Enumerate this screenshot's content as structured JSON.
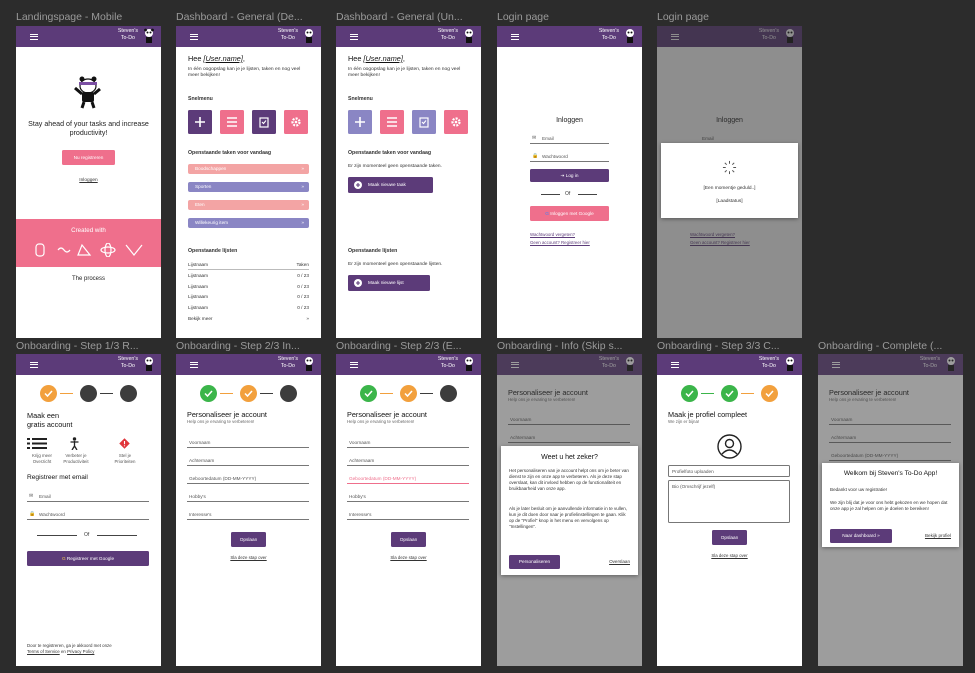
{
  "brand": {
    "line1": "Steven's",
    "line2": "To-Do"
  },
  "frames": [
    {
      "label": "Landingspage - Mobile"
    },
    {
      "label": "Dashboard - General (De..."
    },
    {
      "label": "Dashboard - General (Un..."
    },
    {
      "label": "Login page"
    },
    {
      "label": "Login page"
    },
    {
      "label": "Onboarding - Step 1/3 R..."
    },
    {
      "label": "Onboarding - Step 2/3 In..."
    },
    {
      "label": "Onboarding - Step 2/3 (E..."
    },
    {
      "label": "Onboarding - Info (Skip s..."
    },
    {
      "label": "Onboarding - Step 3/3 C..."
    },
    {
      "label": "Onboarding - Complete (..."
    }
  ],
  "landing": {
    "tagline": "Stay ahead of your tasks and increase productivity!",
    "register_btn": "Nu registreren",
    "login_link": "Inloggen",
    "created_with": "Created with",
    "process": "The process"
  },
  "dash": {
    "greeting_prefix": "Hee ",
    "user": "[User.name]",
    "greeting_suffix": ",",
    "intro": "In één oogopslag kan je je lijsten, taken en nog veel meer bekijken!",
    "quick_menu": "Snelmenu",
    "tasks_title": "Openstaande taken voor vandaag",
    "tasks": [
      {
        "label": "Boodschappen",
        "color": "#f3a4a4"
      },
      {
        "label": "Sporten",
        "color": "#8a86c4"
      },
      {
        "label": "Eten",
        "color": "#f3a4a4"
      },
      {
        "label": "Willekeurig item",
        "color": "#8a86c4"
      }
    ],
    "arrow": "»",
    "lists_title": "Openstaande lijsten",
    "lists_header": {
      "name": "Lijstnaam",
      "tasks": "Taken"
    },
    "lists": [
      {
        "name": "Lijstnaam",
        "count": "0 / 23"
      },
      {
        "name": "Lijstnaam",
        "count": "0 / 23"
      },
      {
        "name": "Lijstnaam",
        "count": "0 / 23"
      },
      {
        "name": "Lijstnaam",
        "count": "0 / 23"
      }
    ],
    "see_more": "Bekijk meer",
    "see_more_arrow": "»",
    "no_tasks": "Er zijn momenteel geen openstaande taken.",
    "new_task": "Maak nieuwe taak",
    "no_lists": "Er zijn momenteel geen openstaande lijsten.",
    "new_list": "Maak nieuwe lijst"
  },
  "login": {
    "title": "Inloggen",
    "email": "Email",
    "password": "Wachtwoord",
    "login_btn": "Log in",
    "or": "Of",
    "google_btn": "Inloggen met Google",
    "forgot": "Wachtwoord vergeten?",
    "no_account": "Geen account? Registreer hier",
    "loading_title": "[Een momentje geduld..]",
    "loading_status": "[Laadstatus]"
  },
  "onb1": {
    "title_l1": "Maak een",
    "title_l2": "gratis account",
    "features": [
      {
        "l1": "Krijg meer",
        "l2": "Overzicht"
      },
      {
        "l1": "Verbeter je",
        "l2": "Productiviteit"
      },
      {
        "l1": "Stel je",
        "l2": "Prioriteiten"
      }
    ],
    "register_email": "Registreer met email",
    "email": "Email",
    "password": "Wachtwoord",
    "or": "Of",
    "google": "Registreer met Google",
    "terms_prefix": "Door te registreren, ga je akkoord met onze",
    "terms": "Terms of Service",
    "and": "en",
    "privacy": "Privacy Policy"
  },
  "onb2": {
    "title": "Personaliseer je account",
    "subtitle": "Help ons je ervaring te verbeteren!",
    "fields": [
      "Voornaam",
      "Achternaam",
      "Geboortedatum (DD-MM-YYYY)",
      "Hobby's",
      "Interesse's"
    ],
    "save": "Opslaan",
    "skip": "Sla deze stap over"
  },
  "info_modal": {
    "title": "Weet u het zeker?",
    "p1": "Het personaliseren van je account helpt ons om je beter van dienst te zijn en onze app te verbeteren. Als je deze stap overslaat, kan dit invloed hebben op de functionaliteit en bruikbaarheid van onze app.",
    "p2": "Als je later besluit om je aanvullende informatie in te vullen, kun je dit doen door naar je profielinstellingen te gaan. Klik op de \"Profiel\" knop in het menu en vervolgens op \"Instellingen\".",
    "primary": "Personaliseren",
    "secondary": "Overslaan"
  },
  "onb3": {
    "title": "Maak je profiel compleet",
    "subtitle": "We zijn er bijna!",
    "upload": "Profielfoto uploaden",
    "bio": "Bio (Omschrijf jezelf)",
    "save": "Opslaan",
    "skip": "Sla deze stap over"
  },
  "complete": {
    "title": "Welkom bij Steven's To-Do App!",
    "p1": "Bedankt voor uw registratie!",
    "p2": "We zijn blij dat je voor ons hebt gekozen en we hopen dat onze app je zal helpen om je doelen te bereiken!",
    "primary": "Naar dashboard »",
    "secondary": "Bekijk profiel"
  },
  "colors": {
    "purple": "#5c3b79",
    "pink": "#ef6f8c",
    "lavender": "#8a86c4",
    "salmon": "#f3a4a4",
    "green": "#3bb54a",
    "orange": "#f2a03d"
  }
}
